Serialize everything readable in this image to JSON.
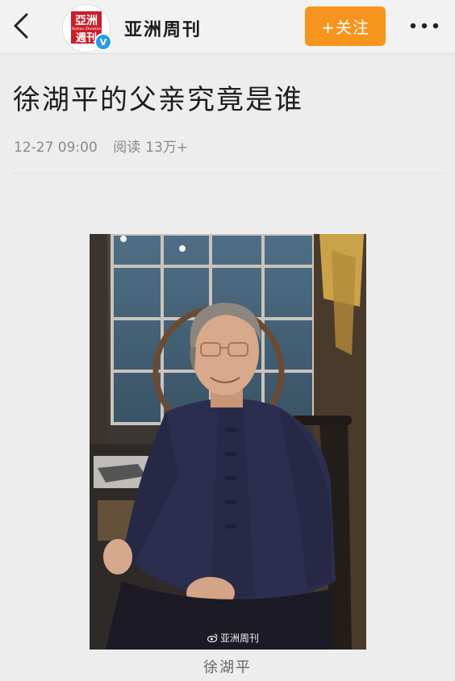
{
  "header": {
    "back_icon": "chevron-left-icon",
    "account_name": "亚洲周刊",
    "avatar_text_top": "亞洲",
    "avatar_text_bottom": "週刊",
    "avatar_subtext": "Yazhou Zhoukan",
    "verified_badge": "V",
    "follow_label": "+关注",
    "more_icon": "more-dots-icon",
    "follow_color": "#f7941d"
  },
  "article": {
    "title": "徐湖平的父亲究竟是谁",
    "date": "12-27 09:00",
    "read_label": "阅读",
    "read_count": "13万+"
  },
  "photo": {
    "watermark": "亚洲周刊",
    "caption": "徐湖平"
  }
}
